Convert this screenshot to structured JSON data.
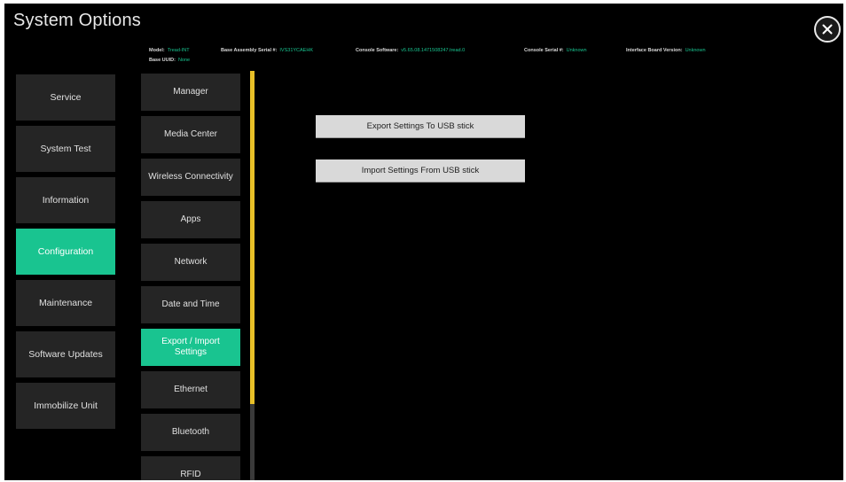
{
  "window": {
    "title": "System Options"
  },
  "info": {
    "model_label": "Model:",
    "model_value": "Tread-INT",
    "base_serial_label": "Base Assembly Serial #:",
    "base_serial_value": "IVS31YCAEHK",
    "console_software_label": "Console Software:",
    "console_software_value": "v5.65.08.1471508247.tread.0",
    "console_serial_label": "Console Serial #:",
    "console_serial_value": "Unknown",
    "interface_board_label": "Interface Board Version:",
    "interface_board_value": "Unknown",
    "base_uuid_label": "Base UUID:",
    "base_uuid_value": "None"
  },
  "left_menu": [
    {
      "label": "Service"
    },
    {
      "label": "System Test"
    },
    {
      "label": "Information"
    },
    {
      "label": "Configuration"
    },
    {
      "label": "Maintenance"
    },
    {
      "label": "Software Updates"
    },
    {
      "label": "Immobilize Unit"
    }
  ],
  "sub_menu": [
    {
      "label": "Manager"
    },
    {
      "label": "Media Center"
    },
    {
      "label": "Wireless Connectivity"
    },
    {
      "label": "Apps"
    },
    {
      "label": "Network"
    },
    {
      "label": "Date and Time"
    },
    {
      "label": "Export / Import Settings"
    },
    {
      "label": "Ethernet"
    },
    {
      "label": "Bluetooth"
    },
    {
      "label": "RFID"
    }
  ],
  "actions": {
    "export_label": "Export Settings To USB stick",
    "import_label": "Import Settings From USB stick"
  },
  "colors": {
    "accent": "#19c490",
    "scroll_thumb": "#e8c028",
    "background": "#000000",
    "tile": "#252525"
  },
  "icons": {
    "close": "close-icon"
  }
}
